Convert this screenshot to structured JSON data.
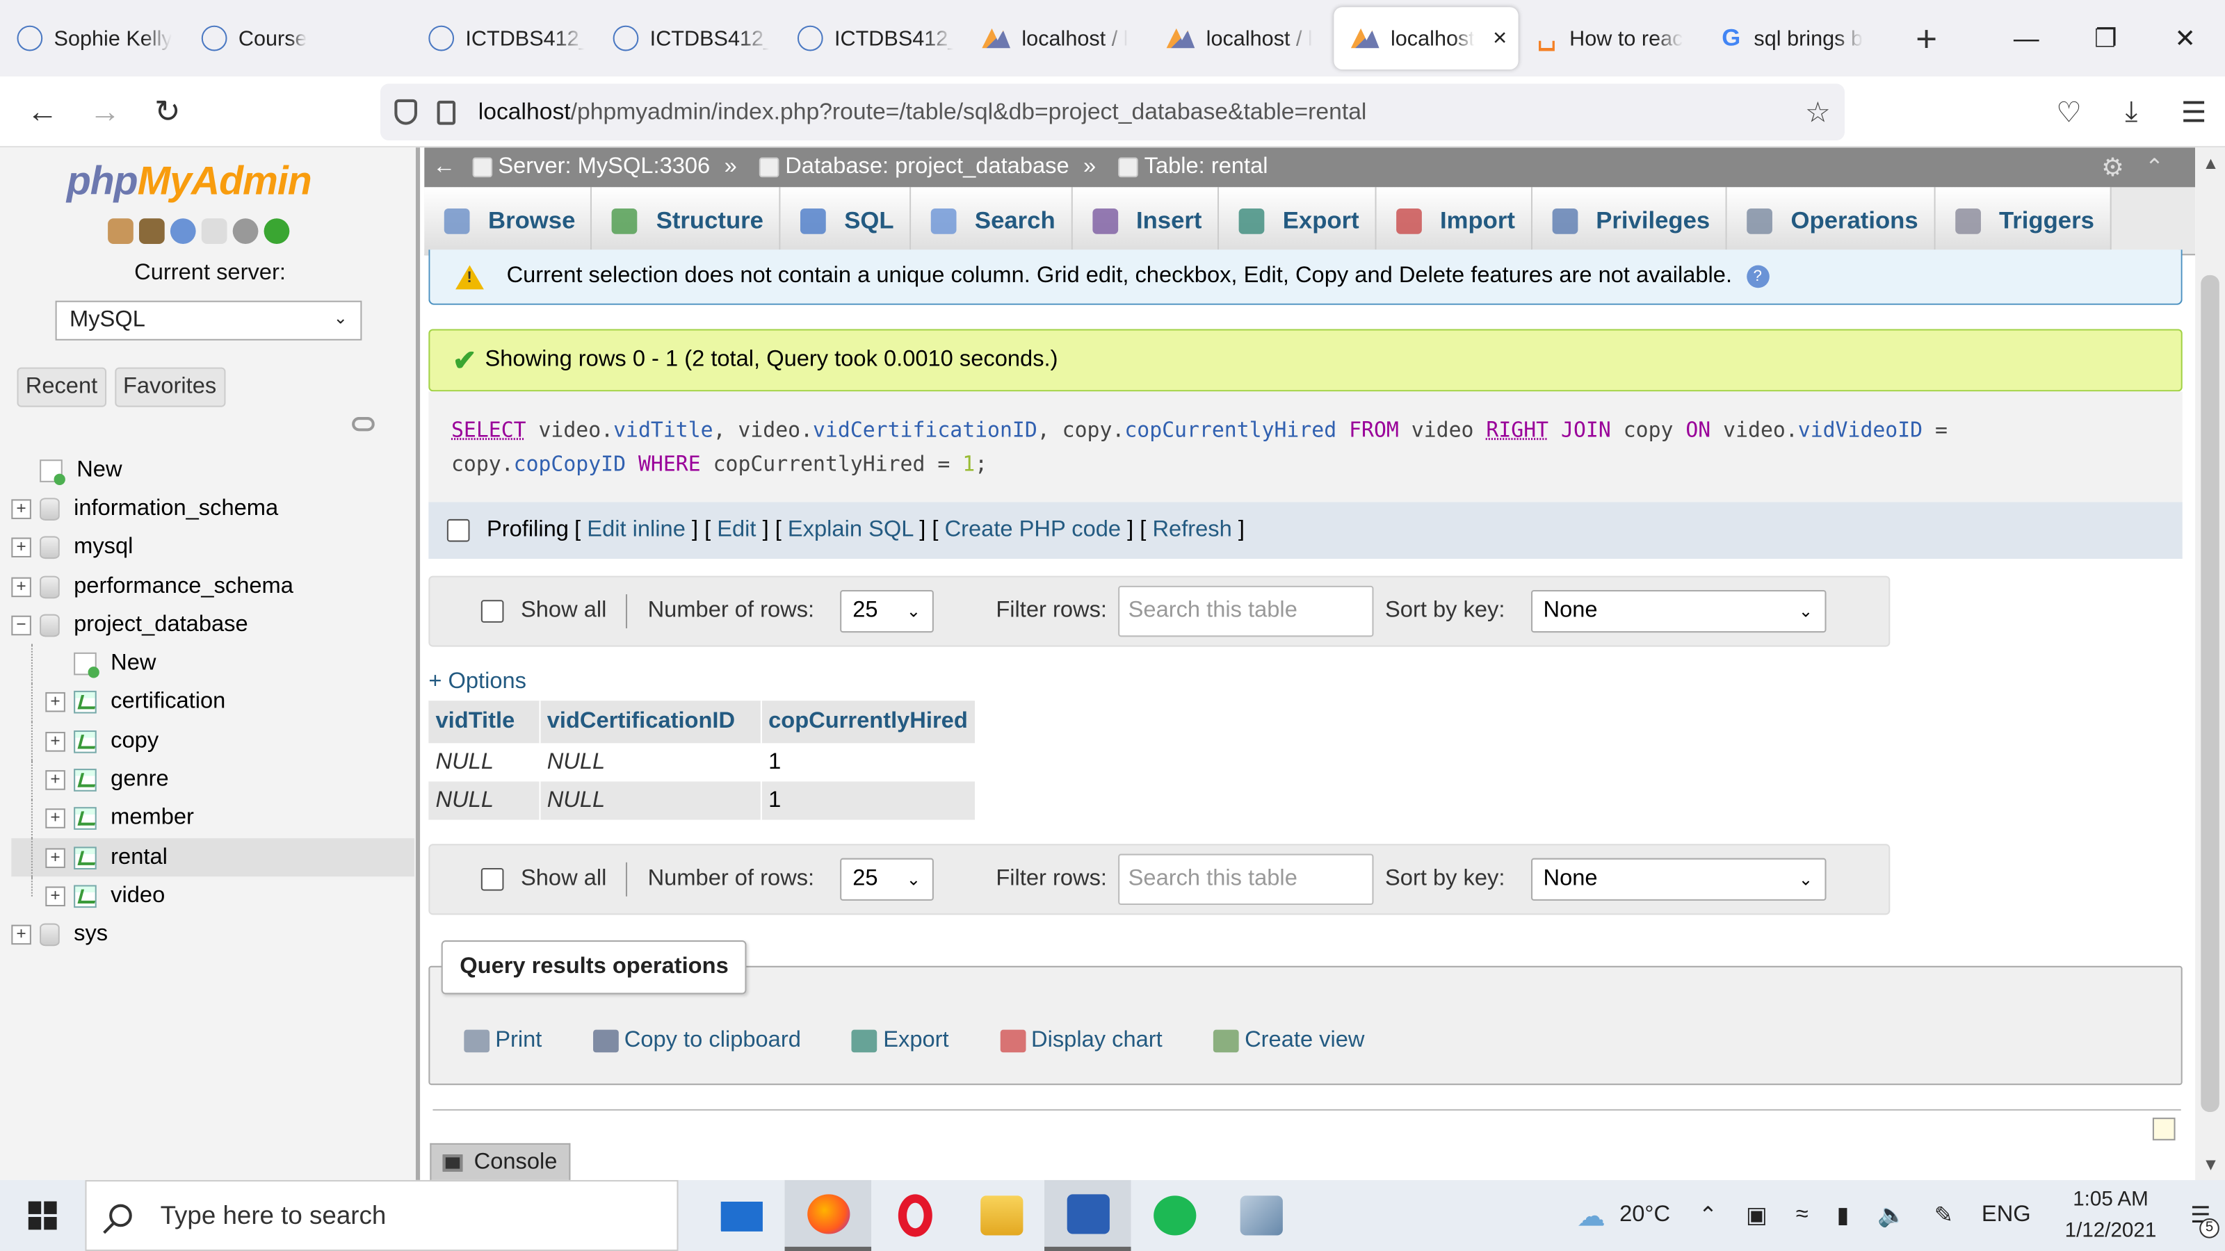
{
  "browser": {
    "tabs": [
      {
        "title": "Sophie Kelly",
        "icon": "tafe-icon"
      },
      {
        "title": "Course",
        "icon": "tafe-icon"
      },
      {
        "title": "ICTDBS412_",
        "icon": "ictdbs-icon"
      },
      {
        "title": "ICTDBS412_",
        "icon": "ictdbs-icon"
      },
      {
        "title": "ICTDBS412_",
        "icon": "ictdbs-icon"
      },
      {
        "title": "localhost / l",
        "icon": "phpmyadmin-icon"
      },
      {
        "title": "localhost / l",
        "icon": "phpmyadmin-icon"
      },
      {
        "title": "localhost",
        "icon": "phpmyadmin-icon",
        "active": true
      },
      {
        "title": "How to reac",
        "icon": "stackoverflow-icon"
      },
      {
        "title": "sql brings b",
        "icon": "google-icon"
      }
    ],
    "url_host": "localhost",
    "url_path": "/phpmyadmin/index.php?route=/table/sql&db=project_database&table=rental"
  },
  "sidebar": {
    "logo_php": "php",
    "logo_myadmin": "MyAdmin",
    "current_server_label": "Current server:",
    "server_value": "MySQL",
    "recent_label": "Recent",
    "favorites_label": "Favorites",
    "tree_new": "New",
    "databases": [
      "information_schema",
      "mysql",
      "performance_schema",
      "project_database"
    ],
    "project_new": "New",
    "tables": [
      "certification",
      "copy",
      "genre",
      "member",
      "rental",
      "video"
    ],
    "sys": "sys"
  },
  "breadcrumb": {
    "server": "Server: MySQL:3306",
    "database": "Database: project_database",
    "table": "Table: rental",
    "separator": "»"
  },
  "menu_tabs": [
    "Browse",
    "Structure",
    "SQL",
    "Search",
    "Insert",
    "Export",
    "Import",
    "Privileges",
    "Operations",
    "Triggers"
  ],
  "notice": "Current selection does not contain a unique column. Grid edit, checkbox, Edit, Copy and Delete features are not available.",
  "success": "Showing rows 0 - 1 (2 total, Query took 0.0010 seconds.)",
  "sql": {
    "line1": "SELECT video.vidTitle, video.vidCertificationID, copy.copCurrentlyHired FROM video RIGHT JOIN copy ON video.vidVideoID =",
    "line2": "copy.copCopyID WHERE copCurrentlyHired = 1;"
  },
  "profiling": {
    "label": "Profiling",
    "links": [
      "Edit inline",
      "Edit",
      "Explain SQL",
      "Create PHP code",
      "Refresh"
    ]
  },
  "nav_controls": {
    "show_all": "Show all",
    "rows_label": "Number of rows:",
    "rows_value": "25",
    "filter_label": "Filter rows:",
    "filter_placeholder": "Search this table",
    "sort_label": "Sort by key:",
    "sort_value": "None"
  },
  "options_link": "+ Options",
  "results": {
    "columns": [
      "vidTitle",
      "vidCertificationID",
      "copCurrentlyHired"
    ],
    "rows": [
      [
        "NULL",
        "NULL",
        "1"
      ],
      [
        "NULL",
        "NULL",
        "1"
      ]
    ]
  },
  "query_ops": {
    "title": "Query results operations",
    "items": [
      "Print",
      "Copy to clipboard",
      "Export",
      "Display chart",
      "Create view"
    ]
  },
  "console_label": "Console",
  "taskbar": {
    "search_placeholder": "Type here to search",
    "weather": "20°C",
    "lang": "ENG",
    "time": "1:05 AM",
    "date": "1/12/2021",
    "notif_count": "5"
  },
  "colors": {
    "pma_blue": "#235a81",
    "success_bg": "#ebf8a4",
    "breadcrumb_bg": "#888888"
  }
}
